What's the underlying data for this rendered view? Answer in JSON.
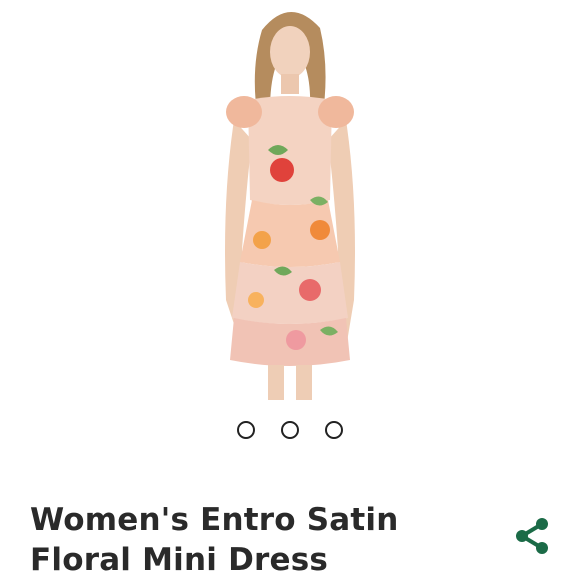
{
  "product": {
    "title": "Women's Entro Satin Floral Mini Dress",
    "image_alt": "Model wearing floral satin mini dress",
    "carousel": {
      "count": 3,
      "active_index": 0
    }
  },
  "icons": {
    "share": "share-icon"
  },
  "colors": {
    "share_icon": "#1b6b47",
    "title_text": "#2a2a2a",
    "dot_border": "#222222"
  }
}
